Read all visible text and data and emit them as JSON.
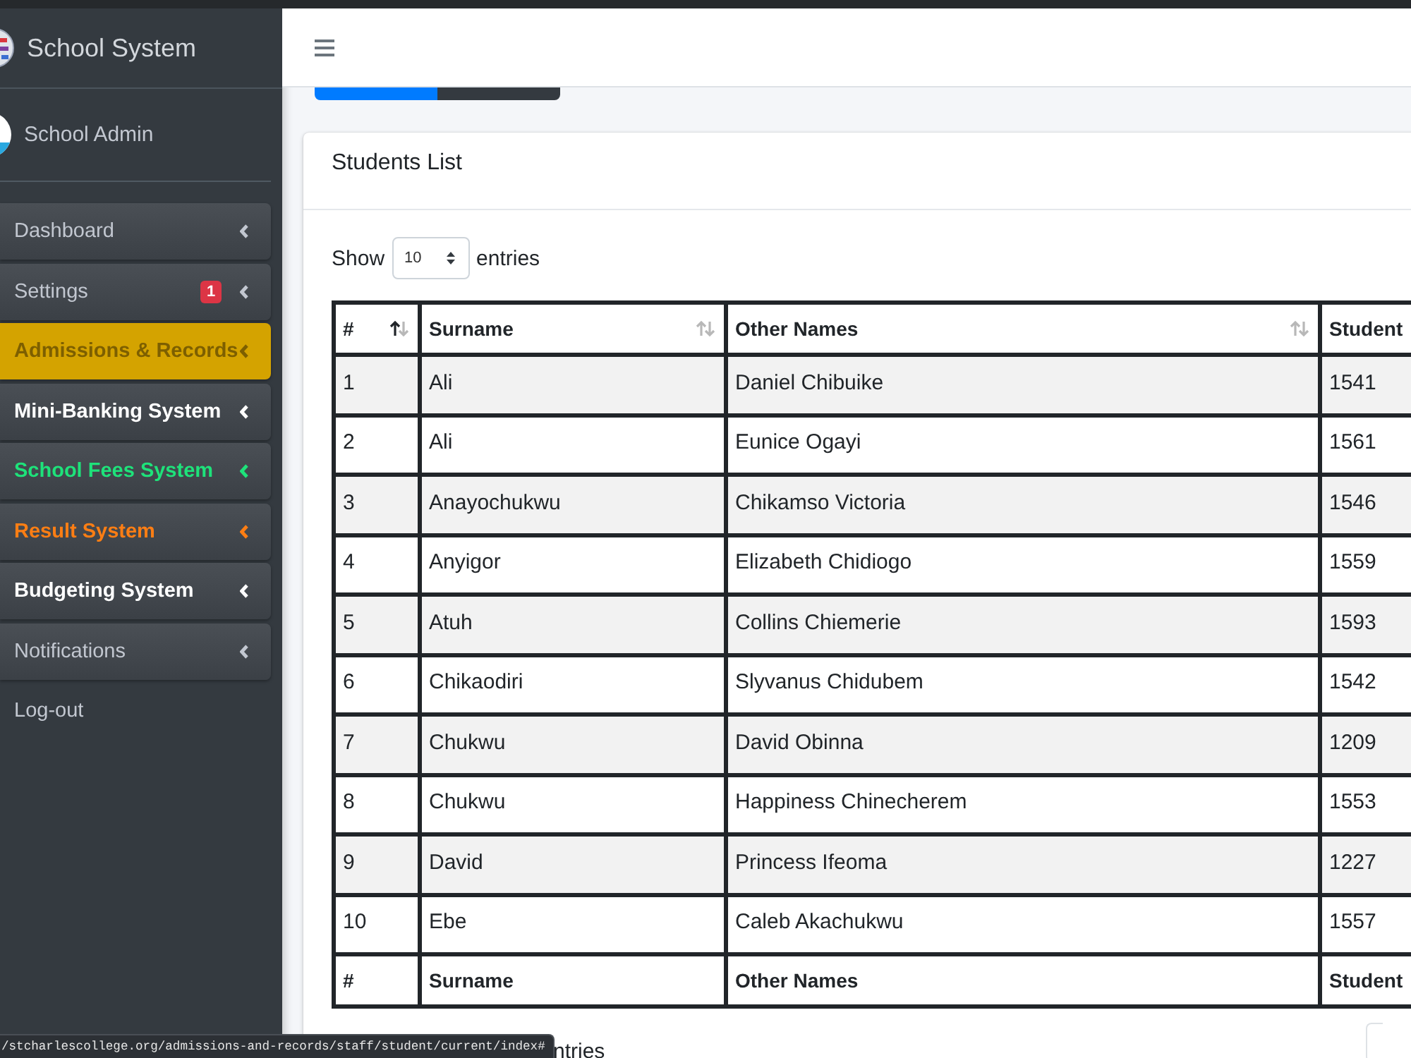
{
  "brand": {
    "title": "School System"
  },
  "user": {
    "name": "School Admin"
  },
  "sidebar": {
    "items": [
      {
        "label": "Dashboard",
        "kind": "submenu",
        "selected": false,
        "bold": false,
        "color": "#c2c7d0"
      },
      {
        "label": "Settings",
        "kind": "submenu",
        "selected": false,
        "bold": false,
        "color": "#c2c7d0",
        "badge": "1"
      },
      {
        "label": "Admissions & Records",
        "kind": "submenu",
        "selected": true,
        "bold": true,
        "color": "#7d5f00"
      },
      {
        "label": "Mini-Banking System",
        "kind": "submenu",
        "selected": false,
        "bold": true,
        "color": "#ffffff"
      },
      {
        "label": "School Fees System",
        "kind": "submenu",
        "selected": false,
        "bold": true,
        "color": "#1ee27a"
      },
      {
        "label": "Result System",
        "kind": "submenu",
        "selected": false,
        "bold": true,
        "color": "#fd7e14"
      },
      {
        "label": "Budgeting System",
        "kind": "submenu",
        "selected": false,
        "bold": true,
        "color": "#ffffff"
      },
      {
        "label": "Notifications",
        "kind": "submenu",
        "selected": false,
        "bold": false,
        "color": "#c2c7d0"
      },
      {
        "label": "Log-out",
        "kind": "link",
        "selected": false,
        "bold": false,
        "color": "#c2c7d0"
      }
    ]
  },
  "card": {
    "title": "Students List",
    "length_menu": {
      "before": "Show",
      "value": "10",
      "after": "entries"
    },
    "table": {
      "columns": [
        {
          "label": "#",
          "sortable": true,
          "sorted": true
        },
        {
          "label": "Surname",
          "sortable": true,
          "sorted": false
        },
        {
          "label": "Other Names",
          "sortable": true,
          "sorted": false
        },
        {
          "label": "Student"
        }
      ],
      "rows": [
        [
          "1",
          "Ali",
          "Daniel Chibuike",
          "1541"
        ],
        [
          "2",
          "Ali",
          "Eunice Ogayi",
          "1561"
        ],
        [
          "3",
          "Anayochukwu",
          "Chikamso Victoria",
          "1546"
        ],
        [
          "4",
          "Anyigor",
          "Elizabeth Chidiogo",
          "1559"
        ],
        [
          "5",
          "Atuh",
          "Collins Chiemerie",
          "1593"
        ],
        [
          "6",
          "Chikaodiri",
          "Slyvanus Chidubem",
          "1542"
        ],
        [
          "7",
          "Chukwu",
          "David Obinna",
          "1209"
        ],
        [
          "8",
          "Chukwu",
          "Happiness Chinecherem",
          "1553"
        ],
        [
          "9",
          "David",
          "Princess Ifeoma",
          "1227"
        ],
        [
          "10",
          "Ebe",
          "Caleb Akachukwu",
          "1557"
        ]
      ],
      "footer": [
        "#",
        "Surname",
        "Other Names",
        "Student"
      ]
    },
    "info": "ntries"
  },
  "status_url": "/stcharlescollege.org/admissions-and-records/staff/student/current/index#"
}
